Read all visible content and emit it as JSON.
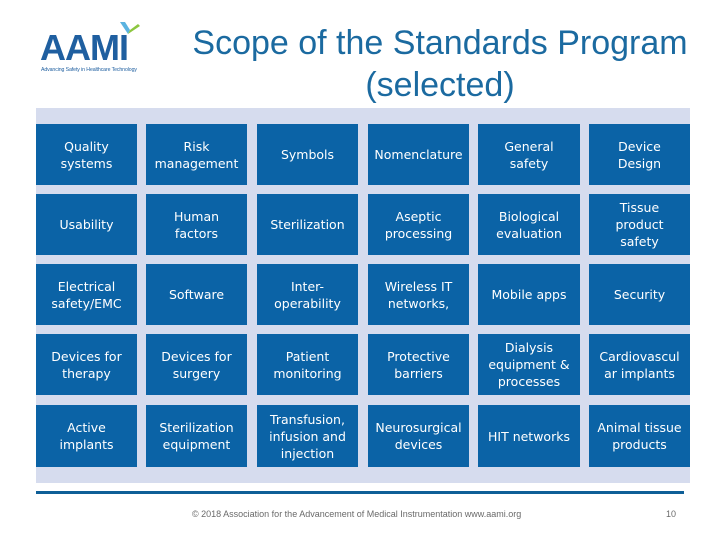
{
  "logo": {
    "name": "AAMI",
    "tagline": "Advancing Safety in Healthcare Technology",
    "colors": {
      "primary": "#1f5fa0",
      "accent_blue": "#5bb3e0",
      "accent_green": "#8cc63f"
    }
  },
  "title": "Scope of the Standards Program (selected)",
  "grid": {
    "rows": [
      [
        "Quality\nsystems",
        "Risk\nmanagement",
        "Symbols",
        "Nomenclature",
        "General\nsafety",
        "Device\nDesign"
      ],
      [
        "Usability",
        "Human\nfactors",
        "Sterilization",
        "Aseptic\nprocessing",
        "Biological\nevaluation",
        "Tissue\nproduct\nsafety"
      ],
      [
        "Electrical\nsafety/EMC",
        "Software",
        "Inter-\noperability",
        "Wireless IT\nnetworks,",
        "Mobile apps",
        "Security"
      ],
      [
        "Devices for\ntherapy",
        "Devices for\nsurgery",
        "Patient\nmonitoring",
        "Protective\nbarriers",
        "Dialysis\nequipment &\nprocesses",
        "Cardiovascul\nar implants"
      ],
      [
        "Active\nimplants",
        "Sterilization\nequipment",
        "Transfusion,\ninfusion and\ninjection",
        "Neurosurgical\ndevices",
        "HIT  networks",
        "Animal tissue\nproducts"
      ]
    ],
    "colors": {
      "tile": "#0b63a6",
      "panel": "#d6dcee",
      "text": "#ffffff"
    }
  },
  "footer": {
    "copyright": "© 2018 Association for the Advancement of Medical Instrumentation  www.aami.org",
    "page_number": "10"
  }
}
